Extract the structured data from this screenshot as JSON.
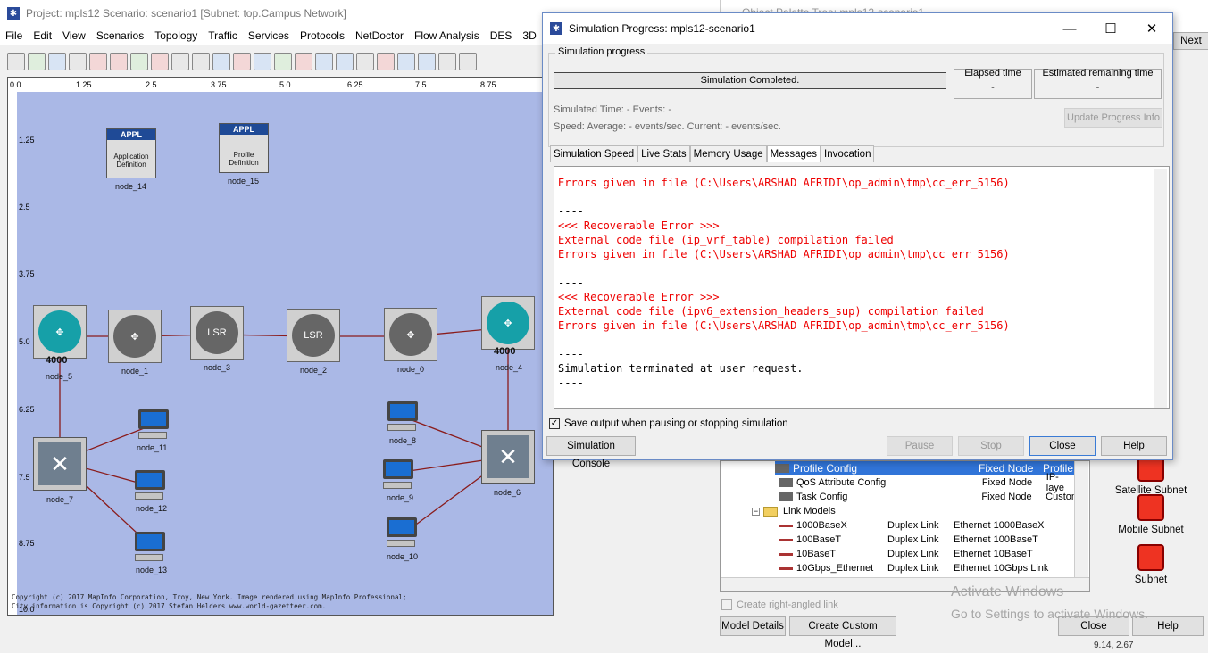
{
  "main_window": {
    "title": "Project: mpls12 Scenario: scenario1  [Subnet: top.Campus Network]",
    "menu": [
      "File",
      "Edit",
      "View",
      "Scenarios",
      "Topology",
      "Traffic",
      "Services",
      "Protocols",
      "NetDoctor",
      "Flow Analysis",
      "DES",
      "3D"
    ]
  },
  "workspace": {
    "x_ticks": [
      "0.0",
      "1.25",
      "2.5",
      "3.75",
      "5.0",
      "6.25",
      "7.5",
      "8.75"
    ],
    "y_ticks": [
      "1.25",
      "2.5",
      "3.75",
      "5.0",
      "6.25",
      "7.5",
      "8.75",
      "10.0"
    ],
    "nodes": {
      "node_14": {
        "label": "node_14",
        "title": "APPL",
        "caption": "Application Definition"
      },
      "node_15": {
        "label": "node_15",
        "title": "APPL",
        "caption": "Profile Definition"
      },
      "node_5": {
        "label": "node_5",
        "badge": "4000"
      },
      "node_1": {
        "label": "node_1"
      },
      "node_3": {
        "label": "node_3",
        "badge": "LSR"
      },
      "node_2": {
        "label": "node_2",
        "badge": "LSR"
      },
      "node_0": {
        "label": "node_0"
      },
      "node_4": {
        "label": "node_4",
        "badge": "4000"
      },
      "node_7": {
        "label": "node_7"
      },
      "node_6": {
        "label": "node_6"
      },
      "node_11": {
        "label": "node_11"
      },
      "node_12": {
        "label": "node_12"
      },
      "node_13": {
        "label": "node_13"
      },
      "node_8": {
        "label": "node_8"
      },
      "node_9": {
        "label": "node_9"
      },
      "node_10": {
        "label": "node_10"
      }
    },
    "copyright_1": "Copyright (c) 2017 MapInfo Corporation, Troy, New York. Image rendered using MapInfo Professional;",
    "copyright_2": "City information is Copyright (c) 2017 Stefan Helders www.world-gazetteer.com."
  },
  "dialog": {
    "title": "Simulation Progress: mpls12-scenario1",
    "group_label": "Simulation progress",
    "progress_text": "Simulation Completed.",
    "elapsed_label": "Elapsed time",
    "elapsed_value": "-",
    "remaining_label": "Estimated remaining time",
    "remaining_value": "-",
    "sim_time_line": "Simulated Time:  -  Events:  -",
    "speed_line": "Speed: Average:  -  events/sec. Current:  -  events/sec.",
    "update_button": "Update Progress Info",
    "tabs": [
      "Simulation Speed",
      "Live Stats",
      "Memory Usage",
      "Messages",
      "Invocation"
    ],
    "messages": [
      {
        "text": "Errors given in file (C:\\Users\\ARSHAD AFRIDI\\op_admin\\tmp\\cc_err_5156)",
        "black": false
      },
      {
        "text": "",
        "black": false
      },
      {
        "text": "----",
        "black": true
      },
      {
        "text": "<<< Recoverable Error >>>",
        "black": false
      },
      {
        "text": "External code file (ip_vrf_table) compilation failed",
        "black": false
      },
      {
        "text": "Errors given in file (C:\\Users\\ARSHAD AFRIDI\\op_admin\\tmp\\cc_err_5156)",
        "black": false
      },
      {
        "text": "",
        "black": false
      },
      {
        "text": "----",
        "black": true
      },
      {
        "text": "<<< Recoverable Error >>>",
        "black": false
      },
      {
        "text": "External code file (ipv6_extension_headers_sup) compilation failed",
        "black": false
      },
      {
        "text": "Errors given in file (C:\\Users\\ARSHAD AFRIDI\\op_admin\\tmp\\cc_err_5156)",
        "black": false
      },
      {
        "text": "",
        "black": false
      },
      {
        "text": "----",
        "black": true
      },
      {
        "text": "Simulation terminated at user request.",
        "black": true
      },
      {
        "text": "----",
        "black": true
      }
    ],
    "save_output_label": "Save output when pausing or stopping simulation",
    "console_button": "Simulation Console",
    "pause_button": "Pause",
    "stop_button": "Stop",
    "close_button": "Close",
    "help_button": "Help"
  },
  "palette": {
    "rows": [
      {
        "name": "Profile Config",
        "type": "Fixed Node",
        "desc": "Profile",
        "selected": true
      },
      {
        "name": "QoS Attribute Config",
        "type": "Fixed Node",
        "desc": "IP-laye",
        "selected": false
      },
      {
        "name": "Task Config",
        "type": "Fixed Node",
        "desc": "Custon",
        "selected": false
      },
      {
        "name": "Link Models",
        "type": "",
        "desc": "",
        "selected": false
      },
      {
        "name": "1000BaseX",
        "type": "Duplex Link",
        "desc": "Ethernet 1000BaseX",
        "selected": false
      },
      {
        "name": "100BaseT",
        "type": "Duplex Link",
        "desc": "Ethernet 100BaseT",
        "selected": false
      },
      {
        "name": "10BaseT",
        "type": "Duplex Link",
        "desc": "Ethernet 10BaseT",
        "selected": false
      },
      {
        "name": "10Gbps_Ethernet",
        "type": "Duplex Link",
        "desc": "Ethernet 10Gbps Link",
        "selected": false
      }
    ],
    "right_angled_label": "Create right-angled link",
    "model_details_button": "Model Details",
    "create_custom_button": "Create Custom Model...",
    "close_button": "Close",
    "help_button": "Help",
    "subnets": [
      "Satellite Subnet",
      "Mobile Subnet",
      "Subnet"
    ],
    "next_button": "Next",
    "background_title": "Object Palette Tree: mpls12-scenario1"
  },
  "watermark": {
    "line1": "Activate Windows",
    "line2": "Go to Settings to activate Windows."
  },
  "status_coords": "9.14, 2.67"
}
